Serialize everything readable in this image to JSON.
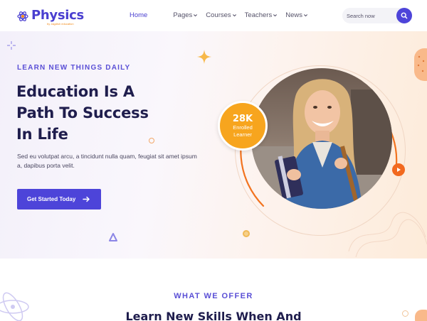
{
  "brand": {
    "name": "Physics",
    "tagline": "by Jagdish education"
  },
  "nav": {
    "items": [
      {
        "label": "Home",
        "active": true,
        "has_dropdown": false
      },
      {
        "label": "Pages",
        "active": false,
        "has_dropdown": true
      },
      {
        "label": "Courses",
        "active": false,
        "has_dropdown": true
      },
      {
        "label": "Teachers",
        "active": false,
        "has_dropdown": true
      },
      {
        "label": "News",
        "active": false,
        "has_dropdown": true
      }
    ]
  },
  "search": {
    "placeholder": "Search now",
    "icon": "search-icon"
  },
  "hero": {
    "eyebrow": "LEARN NEW THINGS DAILY",
    "headline_lines": [
      "Education Is A",
      "Path To Success",
      "In Life"
    ],
    "description": "Sed eu volutpat arcu, a tincidunt nulla quam, feugiat sit amet ipsum a, dapibus porta velit.",
    "cta_label": "Get Started Today",
    "badge": {
      "number": "28K",
      "label_line1": "Enrolled",
      "label_line2": "Learner"
    }
  },
  "offer": {
    "eyebrow": "WHAT WE OFFER",
    "title": "Learn New Skills When And"
  },
  "colors": {
    "primary": "#4d44d9",
    "accent_orange": "#f7a51e",
    "heading": "#1f1d4d"
  }
}
